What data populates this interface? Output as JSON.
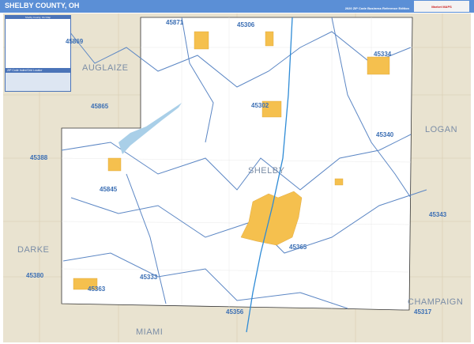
{
  "header": {
    "title": "SHELBY COUNTY, OH",
    "edition": "2020 ZIP Code Business Reference Edition",
    "logo": "Market MAPS"
  },
  "legend": {
    "title": "Shelby County, OH Map",
    "zip_index_title": "ZIP Code Index/Grid Locator"
  },
  "counties": [
    {
      "name": "AUGLAIZE"
    },
    {
      "name": "LOGAN"
    },
    {
      "name": "SHELBY"
    },
    {
      "name": "DARKE"
    },
    {
      "name": "CHAMPAIGN"
    },
    {
      "name": "MIAMI"
    }
  ],
  "zips": [
    "45871",
    "45306",
    "45869",
    "45334",
    "45865",
    "45302",
    "45340",
    "45388",
    "45845",
    "45343",
    "45365",
    "45380",
    "45363",
    "45333",
    "45317",
    "45356"
  ],
  "colors": {
    "header": "#5b8fd6",
    "land": "#e9e3d0",
    "county": "#ffffff",
    "zip_line": "#5b86c4",
    "city": "#f5c04e",
    "water": "#a9cfe8",
    "highway": "#2e8bd6"
  }
}
